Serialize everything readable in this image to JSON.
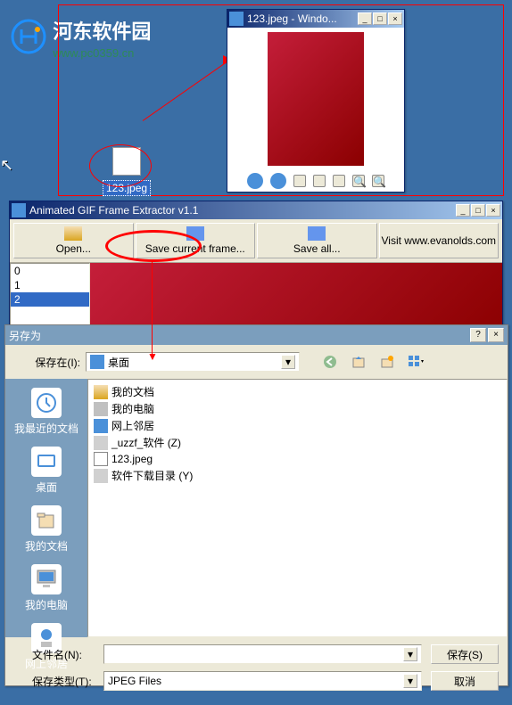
{
  "watermark": {
    "title": "河东软件园",
    "url": "www.pc0359.cn"
  },
  "desktop_icon": {
    "label": "123.jpeg"
  },
  "viewer": {
    "title": "123.jpeg - Windo..."
  },
  "gif_extractor": {
    "title": "Animated GIF Frame Extractor v1.1",
    "buttons": {
      "open": "Open...",
      "save_current": "Save current frame...",
      "save_all": "Save all...",
      "visit": "Visit www.evanolds.com"
    },
    "frames": [
      "0",
      "1",
      "2"
    ]
  },
  "saveas": {
    "title": "另存为",
    "save_in_label": "保存在(I):",
    "location": "桌面",
    "sidebar": [
      {
        "label": "我最近的文档"
      },
      {
        "label": "桌面"
      },
      {
        "label": "我的文档"
      },
      {
        "label": "我的电脑"
      },
      {
        "label": "网上邻居"
      }
    ],
    "files": [
      {
        "name": "我的文档",
        "type": "folder"
      },
      {
        "name": "我的电脑",
        "type": "computer"
      },
      {
        "name": "网上邻居",
        "type": "network"
      },
      {
        "name": "_uzzf_软件 (Z)",
        "type": "drive"
      },
      {
        "name": "123.jpeg",
        "type": "file"
      },
      {
        "name": "软件下载目录 (Y)",
        "type": "drive"
      }
    ],
    "filename_label": "文件名(N):",
    "filetype_label": "保存类型(T):",
    "filetype_value": "JPEG Files",
    "save_btn": "保存(S)",
    "cancel_btn": "取消"
  }
}
